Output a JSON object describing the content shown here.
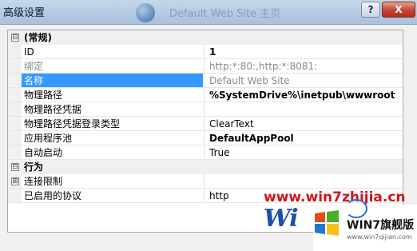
{
  "window": {
    "title": "高级设置",
    "bg_title": "Default Web Site 主页",
    "help_label": "?",
    "close_label": "X"
  },
  "grid": {
    "rows": [
      {
        "kind": "category",
        "expander": "⊟",
        "name": "(常规)"
      },
      {
        "kind": "prop",
        "name": "ID",
        "value": "1",
        "value_bold": true
      },
      {
        "kind": "prop",
        "name": "绑定",
        "value": "http:*:80:,http:*:8081:",
        "grey": true
      },
      {
        "kind": "prop",
        "name": "名称",
        "value": "Default Web Site",
        "selected": true
      },
      {
        "kind": "prop",
        "name": "物理路径",
        "value": "%SystemDrive%\\inetpub\\wwwroot",
        "value_bold": true
      },
      {
        "kind": "prop",
        "name": "物理路径凭据",
        "value": ""
      },
      {
        "kind": "prop",
        "name": "物理路径凭据登录类型",
        "value": "ClearText"
      },
      {
        "kind": "prop",
        "name": "应用程序池",
        "value": "DefaultAppPool",
        "value_bold": true
      },
      {
        "kind": "prop",
        "name": "自动启动",
        "value": "True"
      },
      {
        "kind": "category",
        "expander": "⊟",
        "name": "行为"
      },
      {
        "kind": "prop",
        "name": "连接限制",
        "value": "",
        "expander": "⊞"
      },
      {
        "kind": "prop",
        "name": "已启用的协议",
        "value": "http"
      }
    ]
  },
  "watermark": {
    "url": "www.win7zhijia.cn",
    "logo_text": "Wi",
    "brand": "WIN7旗舰版",
    "site": "www.win7qijian.com"
  }
}
